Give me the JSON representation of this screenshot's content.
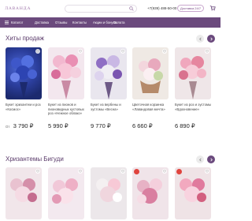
{
  "header": {
    "logo": "ЛАВАНДА",
    "search_placeholder": "",
    "phone": "+7(939) 488-50-00",
    "delivery_badge": "Доставка 24/7"
  },
  "nav": {
    "items": [
      "Каталог",
      "Доставка",
      "Отзывы",
      "Контакты",
      "Акции и бонусы",
      "Оплата"
    ]
  },
  "sections": [
    {
      "title": "Хиты продаж",
      "products": [
        {
          "name": "Букет хризантем и роз «Космос»",
          "price_prefix": "От",
          "price": "3 790 ₽"
        },
        {
          "name": "Букет из пионов и пионовидных кустовых роз «Нежное облако»",
          "price_prefix": "",
          "price": "5 990 ₽"
        },
        {
          "name": "Букет из вербены и эустомы «Весна»",
          "price_prefix": "",
          "price": "9 770 ₽"
        },
        {
          "name": "Цветочная корзинка «Лавандовая мечта»",
          "price_prefix": "",
          "price": "6 660 ₽"
        },
        {
          "name": "Букет из роз и эустомы «Вдохновение»",
          "price_prefix": "",
          "price": "6 890 ₽"
        }
      ]
    },
    {
      "title": "Хризантемы Бигуди",
      "products": []
    }
  ],
  "colors": {
    "brand": "#6b4a7d",
    "badge_red": "#e0443e"
  }
}
